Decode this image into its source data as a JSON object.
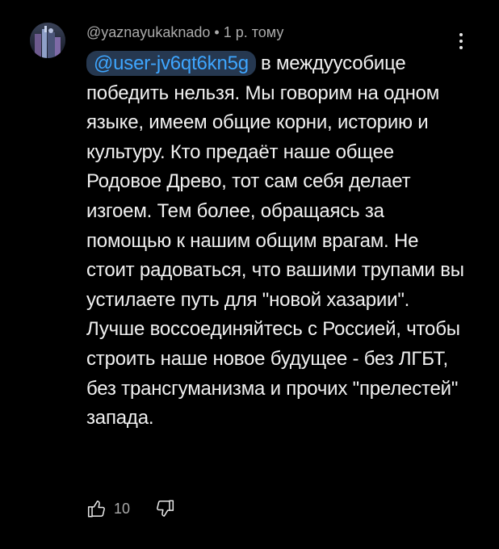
{
  "comment": {
    "author": "@yaznayukaknado",
    "separator": "•",
    "timestamp": "1 р. тому",
    "mention": "@user-jv6qt6kn5g",
    "text": "в междуусобице победить нельзя. Мы говорим на одном языке, имеем общие корни, историю и культуру. Кто предаёт наше общее Родовое Древо, тот сам себя делает изгоем. Тем более, обращаясь за помощью к нашим общим врагам. Не стоит радоваться, что вашими трупами вы устилаете путь для \"новой хазарии\". Лучше воссоединяйтесь с Россией, чтобы строить наше новое будущее - без ЛГБТ, без трансгуманизма и прочих \"прелестей\" запада.",
    "like_count": "10"
  },
  "icons": {
    "avatar": "avatar-image",
    "more": "more-vert-icon",
    "like": "thumb-up-icon",
    "dislike": "thumb-down-icon"
  },
  "colors": {
    "background": "#000000",
    "text": "#f1f1f1",
    "secondary_text": "#aaaaaa",
    "mention_text": "#3ea6ff",
    "mention_bg": "#263850"
  }
}
